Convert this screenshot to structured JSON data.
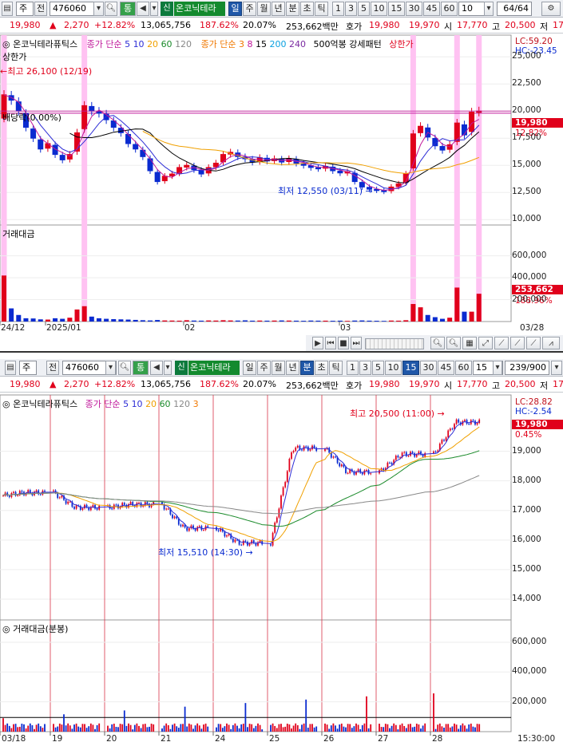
{
  "top": {
    "toolbar": {
      "type_sel": "주",
      "prev_label": "전",
      "code": "476060",
      "tong": "통",
      "sin": "신",
      "name": "온코닉테라",
      "periods": [
        "일",
        "주",
        "월",
        "년",
        "분",
        "초",
        "틱"
      ],
      "active_period": "일",
      "nums": [
        "1",
        "3",
        "5",
        "10",
        "15",
        "30",
        "45",
        "60"
      ],
      "count_val": "10",
      "page": "64/64"
    },
    "quote": {
      "price": "19,980",
      "arrow": "▲",
      "change": "2,270",
      "pct": "+12.82%",
      "volume": "13,065,756",
      "vol_ratio": "187.62%",
      "turnover": "20.07%",
      "amount": "253,662백만",
      "bid_label": "호가",
      "bid": "19,980",
      "ask": "19,970",
      "open_label": "시",
      "open": "17,770",
      "high_label": "고",
      "high": "20,500",
      "low_label": "저",
      "low": "17,7"
    },
    "legend": {
      "name": "온코닉테라퓨틱스",
      "ma_label": "종가 단순",
      "ma1": [
        "5",
        "10",
        "20",
        "60",
        "120"
      ],
      "ma2_label": "종가 단순",
      "ma2": [
        "3",
        "8",
        "15",
        "200",
        "240"
      ],
      "pattern": "500억봉 강세패턴",
      "limit": "상한가"
    },
    "lc": "LC:59.20",
    "hc": "HC:-23.45",
    "limit_label": "상한가",
    "high_ann": "최고 26,100 (12/19)",
    "low_ann": "최저 12,550 (03/11)",
    "ex_label": "배당락(0.00%)",
    "price_tag": "19,980",
    "pct_tag": "12.82%",
    "y_ticks": [
      "25,000",
      "22,500",
      "20,000",
      "17,500",
      "15,000",
      "12,500",
      "10,000"
    ],
    "vol_title": "거래대금",
    "vol_ticks": [
      "600,000",
      "400,000",
      "200,000"
    ],
    "vol_tag": "253,662",
    "vol_pct": "188.96%",
    "dates": [
      "24/12",
      "2025/01",
      "02",
      "03"
    ],
    "last_date": "03/28"
  },
  "bottom": {
    "toolbar": {
      "type_sel": "주",
      "prev_label": "전",
      "code": "476060",
      "tong": "통",
      "sin": "신",
      "name": "온코닉테라",
      "periods": [
        "일",
        "주",
        "월",
        "년",
        "분",
        "초",
        "틱"
      ],
      "active_period": "분",
      "nums": [
        "1",
        "3",
        "5",
        "10",
        "15",
        "30",
        "45",
        "60"
      ],
      "active_num": "15",
      "count_val": "15",
      "page": "239/900"
    },
    "quote": {
      "price": "19,980",
      "arrow": "▲",
      "change": "2,270",
      "pct": "+12.82%",
      "volume": "13,065,756",
      "vol_ratio": "187.62%",
      "turnover": "20.07%",
      "amount": "253,662백만",
      "bid_label": "호가",
      "bid": "19,980",
      "ask": "19,970",
      "open_label": "시",
      "open": "17,770",
      "high_label": "고",
      "high": "20,500",
      "low_label": "저",
      "low": "17"
    },
    "legend": {
      "name": "온코닉테라퓨틱스",
      "ma_label": "종가 단순",
      "ma": [
        "5",
        "10",
        "20",
        "60",
        "120",
        "3"
      ]
    },
    "lc": "LC:28.82",
    "hc": "HC:-2.54",
    "high_ann": "최고 20,500 (11:00)",
    "low_ann": "최저 15,510 (14:30)",
    "price_tag": "19,980",
    "pct_tag": "0.45%",
    "y_ticks": [
      "19,000",
      "18,000",
      "17,000",
      "16,000",
      "15,000",
      "14,000"
    ],
    "vol_title": "거래대금(분봉)",
    "vol_ticks": [
      "600,000",
      "400,000",
      "200,000"
    ],
    "dates": [
      "03/18",
      "19",
      "20",
      "21",
      "24",
      "25",
      "26",
      "27",
      "28"
    ],
    "last_time": "15:30:00"
  },
  "colors": {
    "up": "#e0001b",
    "down": "#0a2bd0",
    "ma5": "#2d2dd6",
    "ma20": "#f0a000",
    "ma60": "#1a8a2a",
    "ma120": "#888888",
    "limit": "#ffc2f2"
  },
  "chart_data": [
    {
      "type": "candlestick",
      "title": "온코닉테라퓨틱스 일봉",
      "y_range": [
        9500,
        27000
      ],
      "annotations": {
        "high": 26100,
        "high_date": "12/19",
        "low": 12550,
        "low_date": "03/11",
        "last": 19980
      },
      "closes": [
        21500,
        21000,
        20000,
        18500,
        17500,
        16500,
        17000,
        16000,
        15500,
        16000,
        18000,
        20500,
        20000,
        19800,
        19200,
        18500,
        18000,
        17000,
        16500,
        15800,
        14500,
        13500,
        14000,
        14200,
        14800,
        15000,
        14600,
        14200,
        14800,
        15200,
        16000,
        16200,
        15800,
        15600,
        15300,
        15700,
        15400,
        15600,
        15300,
        15600,
        15200,
        15000,
        14800,
        14700,
        14900,
        14500,
        14300,
        14400,
        13500,
        13000,
        12800,
        12700,
        12600,
        13000,
        13300,
        14200,
        17900,
        18600,
        17600,
        16800,
        16400,
        16900,
        18900,
        17800,
        19900,
        20000
      ]
    },
    {
      "type": "candlestick",
      "title": "온코닉테라퓨틱스 15분봉",
      "y_range": [
        13300,
        20900
      ],
      "annotations": {
        "high": 20500,
        "high_time": "11:00",
        "low": 15510,
        "low_time": "14:30",
        "last": 19980
      },
      "days": [
        "03/18",
        "19",
        "20",
        "21",
        "24",
        "25",
        "26",
        "27",
        "28"
      ],
      "day_closes": [
        17600,
        17100,
        17200,
        16400,
        15900,
        19100,
        18300,
        18900,
        19980
      ]
    }
  ]
}
